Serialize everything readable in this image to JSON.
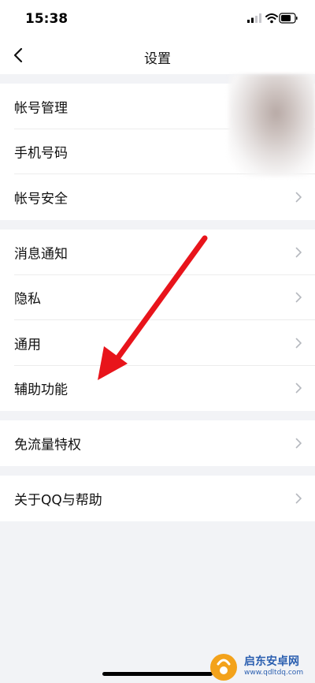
{
  "status_bar": {
    "time": "15:38"
  },
  "nav": {
    "title": "设置"
  },
  "groups": [
    {
      "items": [
        {
          "label": "帐号管理"
        },
        {
          "label": "手机号码"
        },
        {
          "label": "帐号安全"
        }
      ]
    },
    {
      "items": [
        {
          "label": "消息通知"
        },
        {
          "label": "隐私"
        },
        {
          "label": "通用"
        },
        {
          "label": "辅助功能"
        }
      ]
    },
    {
      "items": [
        {
          "label": "免流量特权"
        }
      ]
    },
    {
      "items": [
        {
          "label": "关于QQ与帮助"
        }
      ]
    }
  ],
  "watermark": {
    "title": "启东安卓网",
    "url": "www.qdltdq.com"
  },
  "colors": {
    "annotation": "#e8141b",
    "background": "#f2f3f6",
    "chevron": "#b5b8be"
  },
  "icons": {
    "back": "chevron-left-icon",
    "row": "chevron-right-icon",
    "signal": "signal-icon",
    "wifi": "wifi-icon",
    "battery": "battery-icon"
  }
}
